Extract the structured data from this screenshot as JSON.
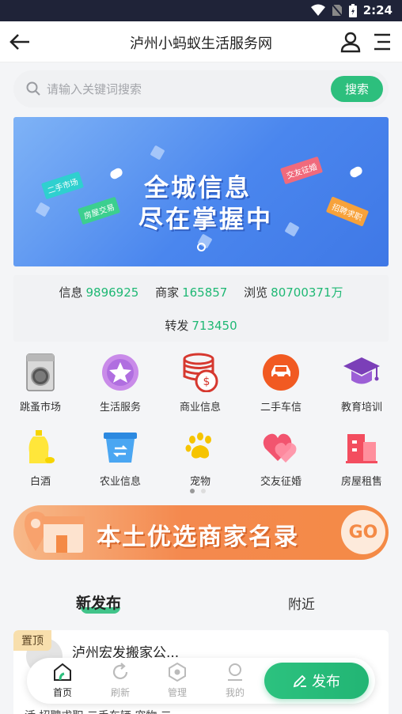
{
  "status_bar": {
    "time": "2:24"
  },
  "nav": {
    "title": "泸州小蚂蚁生活服务网"
  },
  "search": {
    "placeholder": "请输入关键词搜索",
    "button": "搜索"
  },
  "banner": {
    "line1": "全城信息",
    "line2": "尽在掌握中",
    "tags": [
      "二手市场",
      "房屋交易",
      "交友征婚",
      "招聘求职"
    ]
  },
  "stats": {
    "info_label": "信息",
    "info_value": "9896925",
    "merchant_label": "商家",
    "merchant_value": "165857",
    "views_label": "浏览",
    "views_value": "80700371万",
    "shares_label": "转发",
    "shares_value": "713450"
  },
  "categories": [
    {
      "label": "跳蚤市场",
      "icon": "washing-machine-icon"
    },
    {
      "label": "生活服务",
      "icon": "star-icon"
    },
    {
      "label": "商业信息",
      "icon": "coins-icon"
    },
    {
      "label": "二手车信",
      "icon": "car-icon"
    },
    {
      "label": "教育培训",
      "icon": "graduation-cap-icon"
    },
    {
      "label": "白酒",
      "icon": "liquor-bottle-icon"
    },
    {
      "label": "农业信息",
      "icon": "basket-icon"
    },
    {
      "label": "宠物",
      "icon": "paw-icon"
    },
    {
      "label": "交友征婚",
      "icon": "heart-icon"
    },
    {
      "label": "房屋租售",
      "icon": "building-icon"
    }
  ],
  "merchant_banner": {
    "text": "本土优选商家名录",
    "go": "GO"
  },
  "feed_tabs": {
    "new": "新发布",
    "nearby": "附近"
  },
  "post": {
    "pin": "置顶",
    "title": "泸州宏发搬家公...",
    "snippet": "活 招聘求职 二手车辆 宠物 二"
  },
  "bottom_nav": {
    "home": "首页",
    "refresh": "刷新",
    "manage": "管理",
    "mine": "我的",
    "publish": "发布"
  },
  "colors": {
    "accent": "#2dbf7d",
    "status_bar": "#1f2338",
    "banner_blue": "#4a86ee",
    "merchant_orange": "#f48a46"
  }
}
